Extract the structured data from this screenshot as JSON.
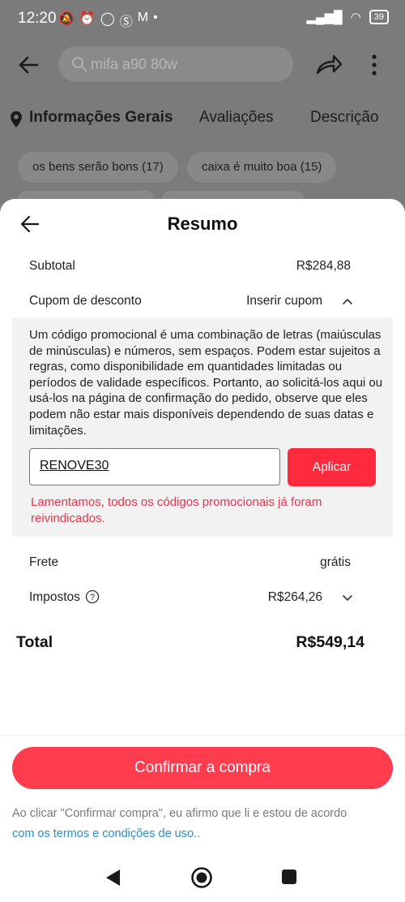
{
  "status_bar": {
    "time": "12:20",
    "battery": "39"
  },
  "background": {
    "search_text": "mifa a90 80w",
    "tabs": [
      "Informações Gerais",
      "Avaliações",
      "Descrição"
    ],
    "chips": [
      "os bens serão bons (17)",
      "caixa é muito boa (15)"
    ]
  },
  "sheet": {
    "title": "Resumo",
    "subtotal_label": "Subtotal",
    "subtotal_value": "R$284,88",
    "coupon_label": "Cupom de desconto",
    "coupon_action": "Inserir cupom",
    "promo_info": "Um código promocional é uma combinação de letras (maiúsculas de minúsculas) e números, sem espaços. Podem estar sujeitos a regras, como disponibilidade em quantidades limitadas ou períodos de validade específicos. Portanto, ao solicitá-los aqui ou usá-los na página de confirmação do pedido, observe que eles podem não estar mais disponíveis dependendo de suas datas e limitações.",
    "coupon_value": "RENOVE30",
    "apply_label": "Aplicar",
    "promo_error": "Lamentamos, todos os códigos promocionais já foram reivindicados.",
    "shipping_label": "Frete",
    "shipping_value": "grátis",
    "taxes_label": "Impostos",
    "taxes_value": "R$264,26",
    "total_label": "Total",
    "total_value": "R$549,14",
    "confirm_label": "Confirmar a compra",
    "terms_text": "Ao clicar \"Confirmar compra\", eu afirmo que li e estou de acordo",
    "terms_link": "com os termos e condições de uso.."
  },
  "colors": {
    "accent": "#ff3d4f",
    "error": "#e8344e",
    "link": "#2d8ec0"
  }
}
